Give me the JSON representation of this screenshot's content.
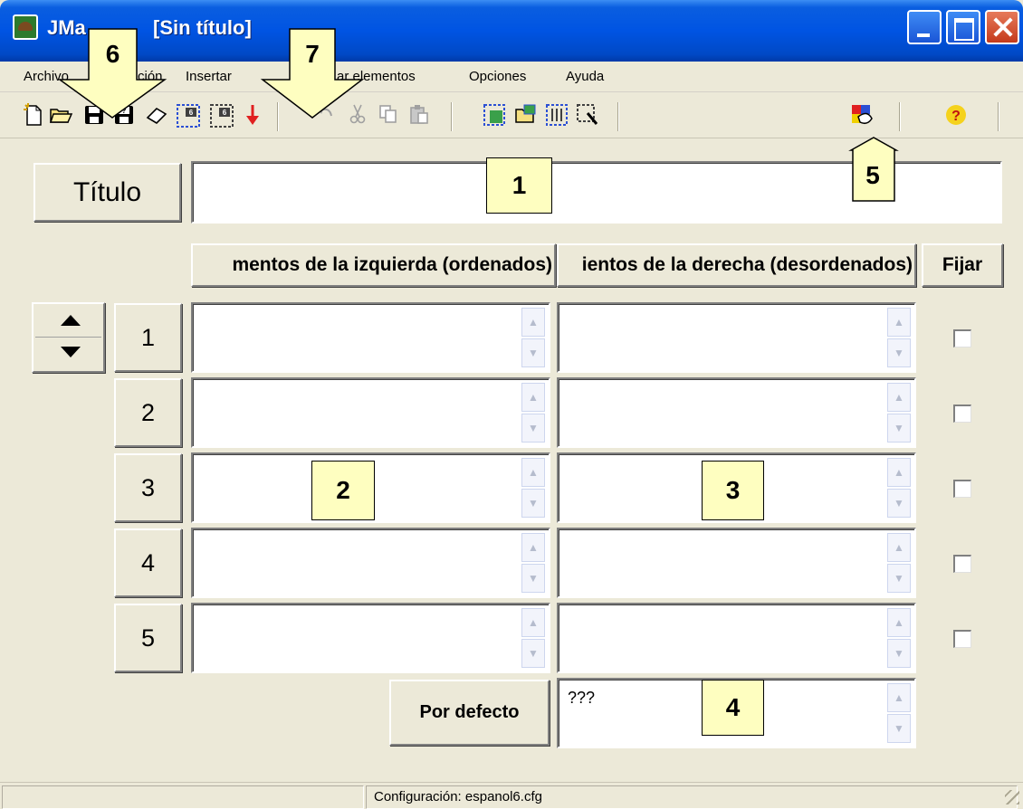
{
  "window": {
    "title": "JMatch [Sin título]",
    "title_visible": "JMa",
    "title_bracket": "[Sin título]"
  },
  "menu": {
    "items": [
      {
        "label": "Archivo"
      },
      {
        "label": "Edición"
      },
      {
        "label": "Insertar"
      },
      {
        "label": "Gestionar elementos"
      },
      {
        "label": "Opciones"
      },
      {
        "label": "Ayuda"
      }
    ],
    "visible_parts": {
      "archivo": "Archivo",
      "edicion": "ción",
      "insertar": "Insertar",
      "gestionar": "ar elementos",
      "opciones": "Opciones",
      "ayuda": "Ayuda"
    }
  },
  "toolbar": {
    "buttons": [
      {
        "icon": "new-file-icon",
        "glyph": "🗋"
      },
      {
        "icon": "open-folder-icon",
        "glyph": "📂"
      },
      {
        "icon": "save-icon",
        "glyph": "💾"
      },
      {
        "icon": "save-as-icon",
        "glyph": "🖫"
      },
      {
        "icon": "eraser-icon",
        "glyph": "◊"
      },
      {
        "icon": "create-web-page-v6-icon",
        "glyph": "▦"
      },
      {
        "icon": "create-dragdrop-v6-icon",
        "glyph": "▩"
      },
      {
        "icon": "export-arrow-icon",
        "glyph": "↓"
      },
      {
        "icon": "undo-icon",
        "glyph": "↶"
      },
      {
        "icon": "cut-icon",
        "glyph": "✂"
      },
      {
        "icon": "copy-icon",
        "glyph": "⧉"
      },
      {
        "icon": "paste-icon",
        "glyph": "📋"
      },
      {
        "icon": "config-icon",
        "glyph": "▣"
      },
      {
        "icon": "open-config-icon",
        "glyph": "▤"
      },
      {
        "icon": "settings-grid-icon",
        "glyph": "▥"
      },
      {
        "icon": "tools-icon",
        "glyph": "▧"
      },
      {
        "icon": "colors-icon",
        "glyph": "▨"
      },
      {
        "icon": "help-icon",
        "glyph": "?"
      }
    ],
    "colors": {
      "export_arrow": "#e02020",
      "help": "#d4a000"
    }
  },
  "form": {
    "title_button": "Título",
    "title_value": "",
    "headers": {
      "left": "mentos de la izquierda (ordenados)",
      "right": "ientos de la derecha (desordenados)",
      "fix": "Fijar"
    },
    "rows": [
      {
        "num": "1",
        "left": "",
        "right": "",
        "fixed": false
      },
      {
        "num": "2",
        "left": "",
        "right": "",
        "fixed": false
      },
      {
        "num": "3",
        "left": "",
        "right": "",
        "fixed": false
      },
      {
        "num": "4",
        "left": "",
        "right": "",
        "fixed": false
      },
      {
        "num": "5",
        "left": "",
        "right": "",
        "fixed": false
      }
    ],
    "default_button": "Por defecto",
    "default_value": "???"
  },
  "status": {
    "config": "Configuración: espanol6.cfg"
  },
  "callouts": [
    "1",
    "2",
    "3",
    "4",
    "5",
    "6",
    "7"
  ],
  "colors": {
    "titlebar": "#0054e3",
    "window_bg": "#ece9d8",
    "callout_bg": "#fefec0"
  }
}
